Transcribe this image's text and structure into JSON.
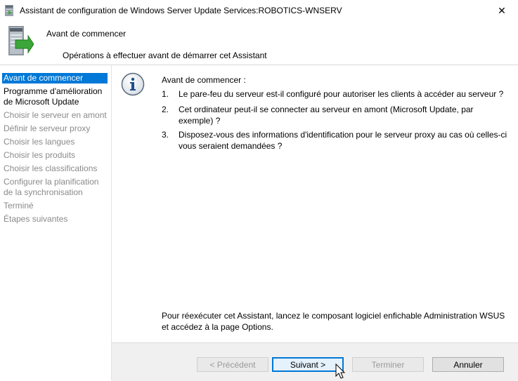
{
  "window": {
    "title": "Assistant de configuration de Windows Server Update Services:ROBOTICS-WNSERV",
    "icon": "wsus-server-icon",
    "close_glyph": "✕"
  },
  "header": {
    "title": "Avant de commencer",
    "subtitle": "Opérations à effectuer avant de démarrer cet Assistant",
    "icon": "server-install-icon"
  },
  "sidebar": {
    "items": [
      {
        "label": "Avant de commencer",
        "state": "active"
      },
      {
        "label": "Programme d'amélioration de Microsoft Update",
        "state": "current"
      },
      {
        "label": "Choisir le serveur en amont",
        "state": "disabled"
      },
      {
        "label": "Définir le serveur proxy",
        "state": "disabled"
      },
      {
        "label": "Choisir les langues",
        "state": "disabled"
      },
      {
        "label": "Choisir les produits",
        "state": "disabled"
      },
      {
        "label": "Choisir les classifications",
        "state": "disabled"
      },
      {
        "label": "Configurer la planification de la synchronisation",
        "state": "disabled"
      },
      {
        "label": "Terminé",
        "state": "disabled"
      },
      {
        "label": "Étapes suivantes",
        "state": "disabled"
      }
    ]
  },
  "content": {
    "intro": "Avant de commencer :",
    "questions": [
      {
        "num": "1.",
        "text": "Le pare-feu du serveur est-il configuré pour autoriser les clients à accéder au serveur ?"
      },
      {
        "num": "2.",
        "text": "Cet ordinateur peut-il se connecter au serveur en amont (Microsoft Update, par exemple) ?"
      },
      {
        "num": "3.",
        "text": "Disposez-vous des informations d'identification pour le serveur proxy au cas où celles-ci vous seraient demandées ?"
      }
    ],
    "footer_note": "Pour réexécuter cet Assistant, lancez le composant logiciel enfichable Administration WSUS et accédez à la page Options."
  },
  "buttons": {
    "previous": "< Précédent",
    "next": "Suivant >",
    "finish": "Terminer",
    "cancel": "Annuler"
  },
  "colors": {
    "selection": "#0078d7",
    "disabled_text": "#8a8a8a",
    "button_bar": "#f0f0f0"
  }
}
